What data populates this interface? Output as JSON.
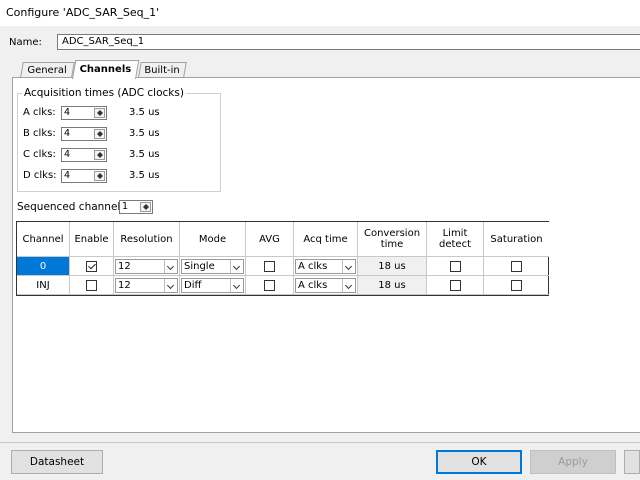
{
  "window": {
    "title": "Configure 'ADC_SAR_Seq_1'"
  },
  "name_field": {
    "label": "Name:",
    "value": "ADC_SAR_Seq_1"
  },
  "tabs": [
    {
      "label": "General",
      "active": false
    },
    {
      "label": "Channels",
      "active": true
    },
    {
      "label": "Built-in",
      "active": false
    }
  ],
  "acquisition": {
    "title": "Acquisition times (ADC clocks)",
    "rows": [
      {
        "label": "A clks:",
        "value": "4",
        "time": "3.5 us"
      },
      {
        "label": "B clks:",
        "value": "4",
        "time": "3.5 us"
      },
      {
        "label": "C clks:",
        "value": "4",
        "time": "3.5 us"
      },
      {
        "label": "D clks:",
        "value": "4",
        "time": "3.5 us"
      }
    ]
  },
  "sequenced": {
    "label": "Sequenced channels:",
    "value": "1"
  },
  "grid": {
    "headers": [
      "Channel",
      "Enable",
      "Resolution",
      "Mode",
      "AVG",
      "Acq time",
      "Conversion time",
      "Limit detect",
      "Saturation"
    ],
    "rows": [
      {
        "channel": "0",
        "enable": true,
        "resolution": "12",
        "mode": "Single",
        "avg": false,
        "acq": "A clks",
        "conversion": "18 us",
        "limit": false,
        "saturation": false
      },
      {
        "channel": "INJ",
        "enable": false,
        "resolution": "12",
        "mode": "Diff",
        "avg": false,
        "acq": "A clks",
        "conversion": "18 us",
        "limit": false,
        "saturation": false
      }
    ]
  },
  "buttons": {
    "datasheet": "Datasheet",
    "ok": "OK",
    "apply": "Apply"
  },
  "colors": {
    "accent": "#0078d7",
    "panel": "#ffffff",
    "background": "#f0f0f0"
  }
}
